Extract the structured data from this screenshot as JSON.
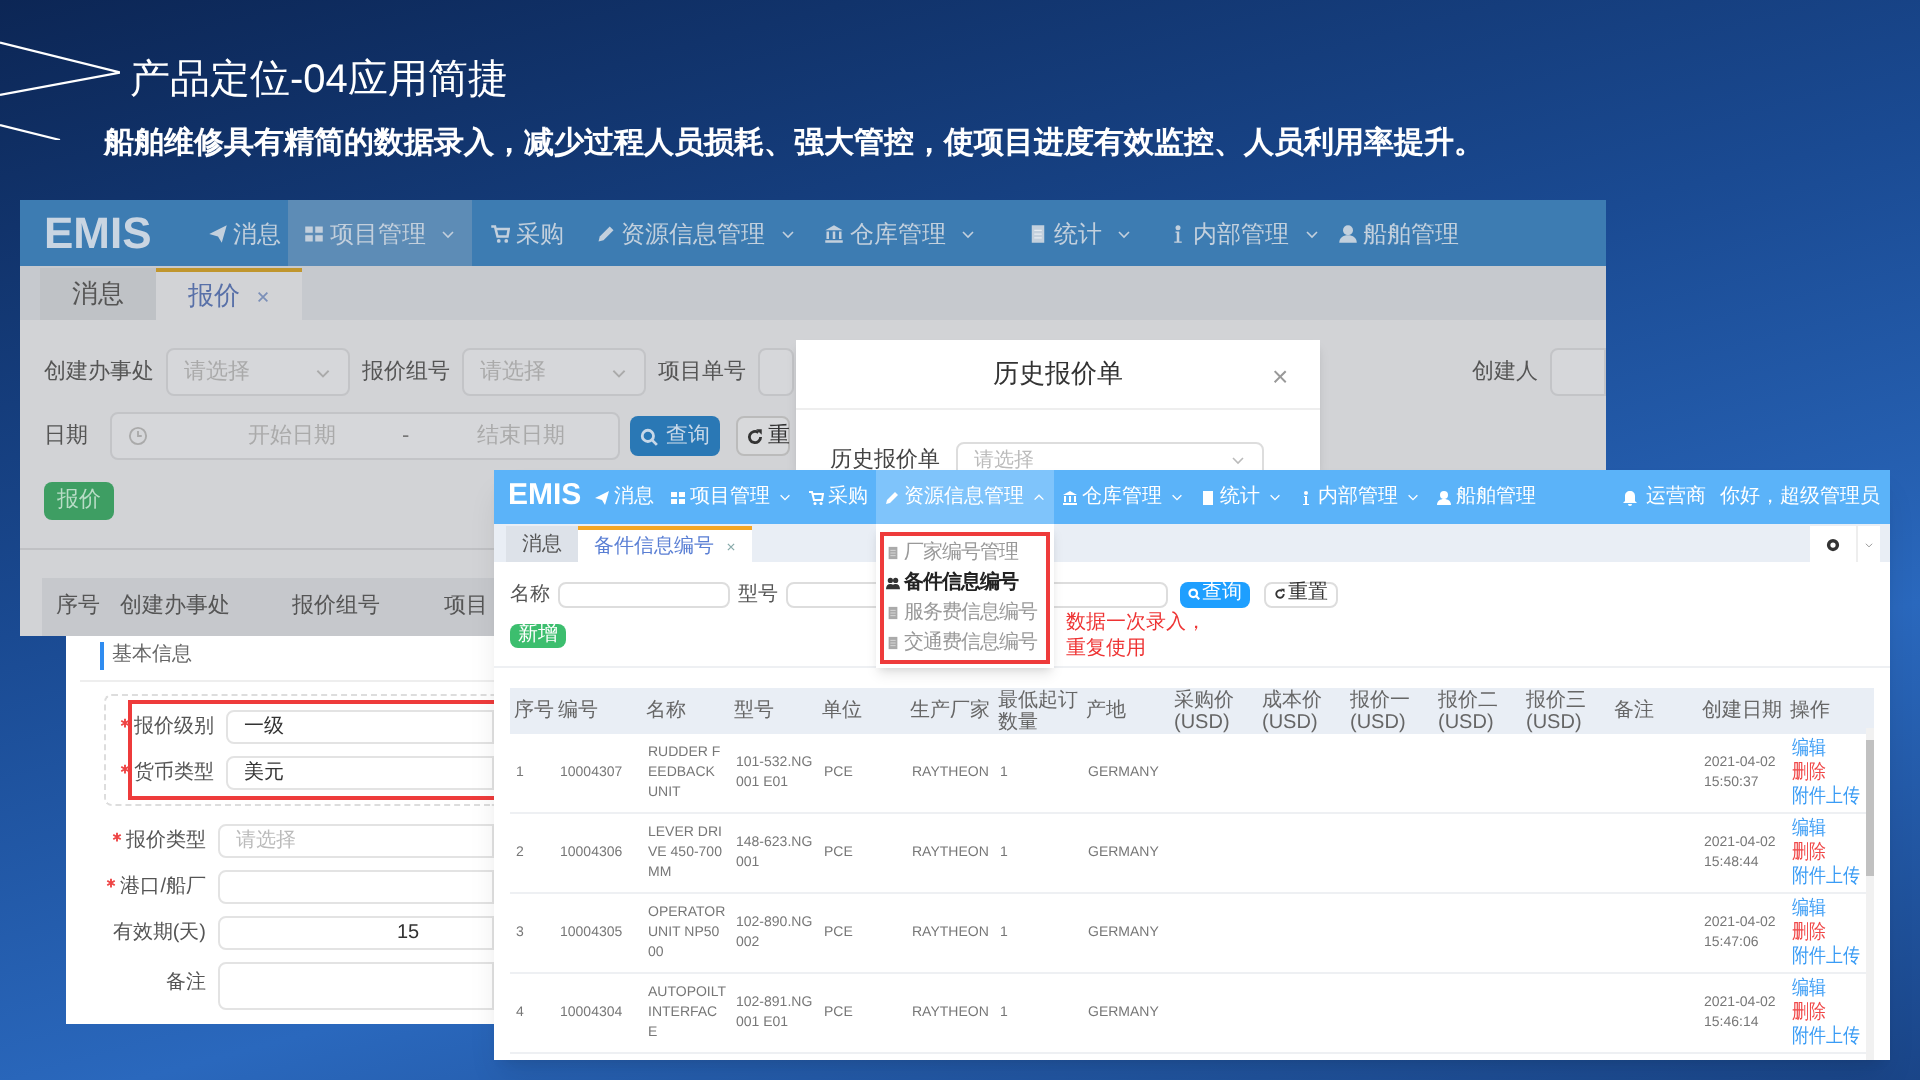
{
  "slide": {
    "title": "产品定位-04应用简捷",
    "subtitle": "船舶维修具有精简的数据录入，减少过程人员损耗、强大管控，使项目进度有效监控、人员利用率提升。"
  },
  "back_window": {
    "logo": "EMIS",
    "nav": [
      {
        "label": "消息",
        "selected": false,
        "caret": false
      },
      {
        "label": "项目管理",
        "selected": true,
        "caret": true
      },
      {
        "label": "采购",
        "selected": false,
        "caret": false
      },
      {
        "label": "资源信息管理",
        "selected": false,
        "caret": true
      },
      {
        "label": "仓库管理",
        "selected": false,
        "caret": true
      },
      {
        "label": "统计",
        "selected": false,
        "caret": true
      },
      {
        "label": "内部管理",
        "selected": false,
        "caret": true
      },
      {
        "label": "船舶管理",
        "selected": false,
        "caret": false
      }
    ],
    "tabs": [
      {
        "label": "消息",
        "selected": false,
        "closable": false
      },
      {
        "label": "报价",
        "selected": true,
        "closable": true
      }
    ],
    "filters": [
      {
        "label": "创建办事处",
        "placeholder": "请选择"
      },
      {
        "label": "报价组号",
        "placeholder": "请选择"
      },
      {
        "label": "项目单号"
      }
    ],
    "creator_label": "创建人",
    "date": {
      "label": "日期",
      "start_placeholder": "开始日期",
      "separator": "-",
      "end_placeholder": "结束日期"
    },
    "search_button": "查询",
    "reset_button": "重",
    "quote_button": "报价",
    "table_columns": [
      "序号",
      "创建办事处",
      "报价组号",
      "项目"
    ]
  },
  "dialog": {
    "title": "历史报价单",
    "close": "×",
    "label": "历史报价单",
    "placeholder": "请选择"
  },
  "form": {
    "section": "基本信息",
    "fields": [
      {
        "label": "报价级别",
        "required": true,
        "kind": "select",
        "value": "一级"
      },
      {
        "label": "货币类型",
        "required": true,
        "kind": "select",
        "value": "美元"
      },
      {
        "label": "报价类型",
        "required": true,
        "kind": "select",
        "placeholder": "请选择"
      },
      {
        "label": "港口/船厂",
        "required": true,
        "kind": "input"
      },
      {
        "label": "有效期(天)",
        "required": false,
        "kind": "number",
        "value": "15"
      },
      {
        "label": "备注",
        "required": false,
        "kind": "textarea"
      }
    ]
  },
  "front_window": {
    "logo": "EMIS",
    "nav": [
      {
        "label": "消息",
        "selected": false,
        "caret": false
      },
      {
        "label": "项目管理",
        "selected": false,
        "caret": true
      },
      {
        "label": "采购",
        "selected": false,
        "caret": false
      },
      {
        "label": "资源信息管理",
        "selected": true,
        "caret": true,
        "expanded": true
      },
      {
        "label": "仓库管理",
        "selected": false,
        "caret": true
      },
      {
        "label": "统计",
        "selected": false,
        "caret": true
      },
      {
        "label": "内部管理",
        "selected": false,
        "caret": true
      },
      {
        "label": "船舶管理",
        "selected": false,
        "caret": false
      }
    ],
    "dropdown": [
      {
        "label": "厂家编号管理",
        "selected": false
      },
      {
        "label": "备件信息编号",
        "selected": true
      },
      {
        "label": "服务费信息编号",
        "selected": false
      },
      {
        "label": "交通费信息编号",
        "selected": false
      }
    ],
    "operator": "运营商",
    "greeting": "你好，超级管理员",
    "tabs": [
      {
        "label": "消息",
        "selected": false,
        "closable": false
      },
      {
        "label": "备件信息编号",
        "selected": true,
        "closable": true
      }
    ],
    "filters": [
      {
        "label": "名称"
      },
      {
        "label": "型号"
      }
    ],
    "search_button": "查询",
    "reset_button": "重置",
    "add_button": "新增",
    "annotation": "数据一次录入，重复使用",
    "columns": [
      "序号",
      "编号",
      "名称",
      "型号",
      "单位",
      "生产厂家",
      "最低起订数量",
      "产地",
      "采购价(USD)",
      "成本价(USD)",
      "报价一(USD)",
      "报价二(USD)",
      "报价三(USD)",
      "备注",
      "创建日期",
      "操作"
    ],
    "rows": [
      {
        "cells": [
          "1",
          "10004307",
          "RUDDER FEEDBACK UNIT",
          "101-532.NG001 E01",
          "PCE",
          "RAYTHEON",
          "1",
          "GERMANY"
        ],
        "created": "2021-04-02 15:50:37",
        "actions": [
          {
            "label": "编辑",
            "kind": "edit"
          },
          {
            "label": "删除",
            "kind": "delete"
          },
          {
            "label": "附件上传",
            "kind": "upload"
          }
        ]
      },
      {
        "cells": [
          "2",
          "10004306",
          "LEVER DRIVE 450-700MM",
          "148-623.NG001",
          "PCE",
          "RAYTHEON",
          "1",
          "GERMANY"
        ],
        "created": "2021-04-02 15:48:44",
        "actions": [
          {
            "label": "编辑",
            "kind": "edit"
          },
          {
            "label": "删除",
            "kind": "delete"
          },
          {
            "label": "附件上传",
            "kind": "upload"
          }
        ]
      },
      {
        "cells": [
          "3",
          "10004305",
          "OPERATOR UNIT NP5000",
          "102-890.NG002",
          "PCE",
          "RAYTHEON",
          "1",
          "GERMANY"
        ],
        "created": "2021-04-02 15:47:06",
        "actions": [
          {
            "label": "编辑",
            "kind": "edit"
          },
          {
            "label": "删除",
            "kind": "delete"
          },
          {
            "label": "附件上传",
            "kind": "upload"
          }
        ]
      },
      {
        "cells": [
          "4",
          "10004304",
          "AUTOPOILT INTERFACE",
          "102-891.NG001 E01",
          "PCE",
          "RAYTHEON",
          "1",
          "GERMANY"
        ],
        "created": "2021-04-02 15:46:14",
        "actions": [
          {
            "label": "编辑",
            "kind": "edit"
          },
          {
            "label": "删除",
            "kind": "delete"
          },
          {
            "label": "附件上传",
            "kind": "upload"
          }
        ]
      }
    ]
  }
}
